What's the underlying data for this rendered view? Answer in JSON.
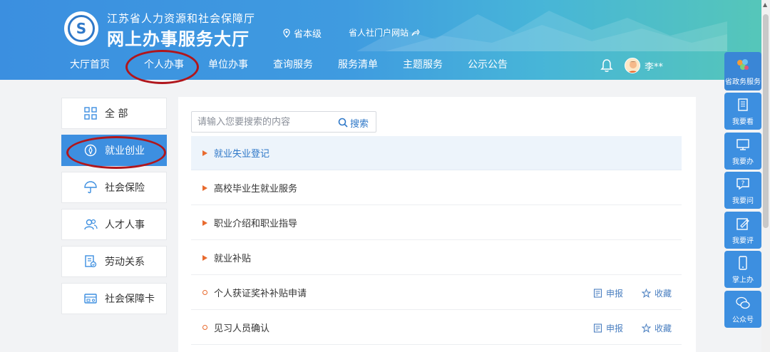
{
  "header": {
    "org_name": "江苏省人力资源和社会保障厅",
    "site_name": "网上办事服务大厅",
    "level": "省本级",
    "portal_link": "省人社门户网站",
    "user_name": "李**"
  },
  "nav": {
    "items": [
      {
        "label": "大厅首页"
      },
      {
        "label": "个人办事"
      },
      {
        "label": "单位办事"
      },
      {
        "label": "查询服务"
      },
      {
        "label": "服务清单"
      },
      {
        "label": "主题服务"
      },
      {
        "label": "公示公告"
      }
    ],
    "active_index": 1
  },
  "sidebar": {
    "items": [
      {
        "label": "全 部",
        "icon": "grid-icon"
      },
      {
        "label": "就业创业",
        "icon": "employment-icon"
      },
      {
        "label": "社会保险",
        "icon": "umbrella-icon"
      },
      {
        "label": "人才人事",
        "icon": "people-icon"
      },
      {
        "label": "劳动关系",
        "icon": "document-icon"
      },
      {
        "label": "社会保障卡",
        "icon": "card-icon"
      }
    ],
    "active_index": 1
  },
  "search": {
    "placeholder": "请输入您要搜索的内容",
    "button_label": "搜索"
  },
  "list": {
    "rows": [
      {
        "label": "就业失业登记",
        "type": "category"
      },
      {
        "label": "高校毕业生就业服务",
        "type": "category"
      },
      {
        "label": "职业介绍和职业指导",
        "type": "category"
      },
      {
        "label": "就业补贴",
        "type": "category"
      },
      {
        "label": "个人获证奖补补贴申请",
        "type": "item",
        "apply_label": "申报",
        "fav_label": "收藏"
      },
      {
        "label": "见习人员确认",
        "type": "item",
        "apply_label": "申报",
        "fav_label": "收藏"
      }
    ]
  },
  "dock": {
    "items": [
      {
        "label": "省政务服务"
      },
      {
        "label": "我要看"
      },
      {
        "label": "我要办"
      },
      {
        "label": "我要问"
      },
      {
        "label": "我要评"
      },
      {
        "label": "掌上办"
      },
      {
        "label": "公众号"
      }
    ]
  },
  "colors": {
    "primary": "#3d8fe0",
    "accent_orange": "#e86a2e",
    "annotation_red": "#b0161c"
  }
}
